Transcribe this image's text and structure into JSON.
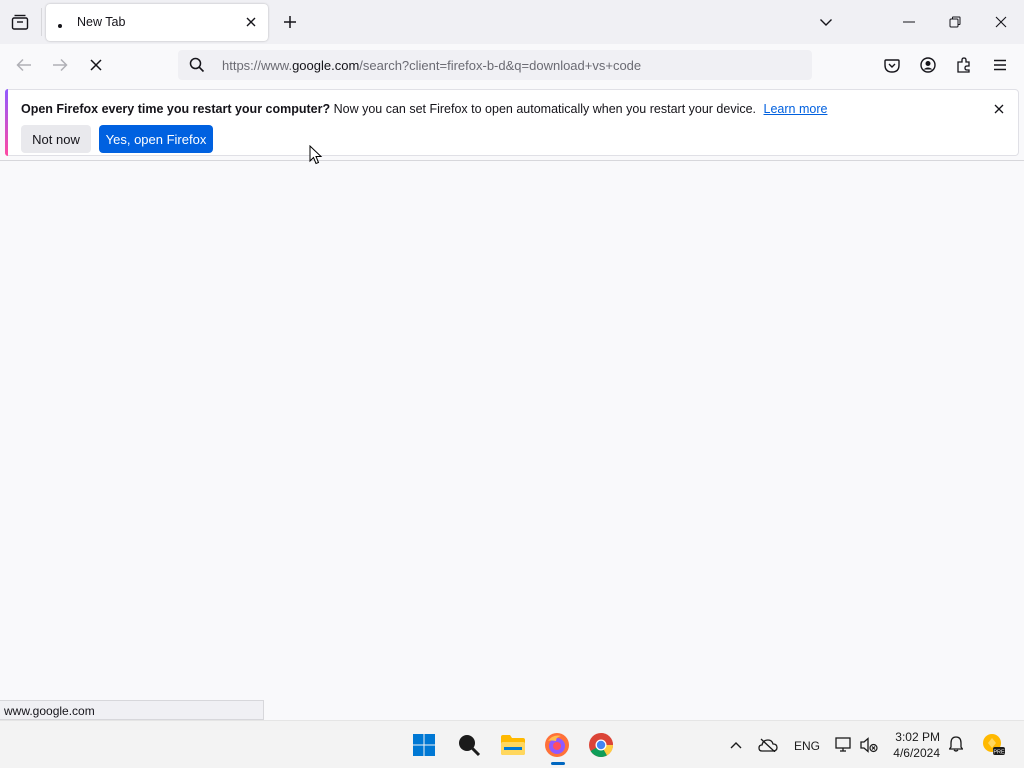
{
  "tabs": [
    {
      "title": "New Tab"
    }
  ],
  "urlbar": {
    "prefix": "https://www.",
    "host": "google.com",
    "rest": "/search?client=firefox-b-d&q=download+vs+code"
  },
  "notification": {
    "headline": "Open Firefox every time you restart your computer?",
    "body": " Now you can set Firefox to open automatically when you restart your device.",
    "link": "Learn more",
    "secondary_button": "Not now",
    "primary_button": "Yes, open Firefox"
  },
  "status_text": "www.google.com",
  "taskbar": {
    "apps": [
      "windows-start",
      "search",
      "file-explorer",
      "firefox",
      "chrome"
    ],
    "language": "ENG",
    "time": "3:02 PM",
    "date": "4/6/2024"
  },
  "colors": {
    "accent_blue": "#0061e0",
    "link_blue": "#0060df",
    "tab_strip": "#f0f0f4",
    "page_bg": "#f9f9fb"
  },
  "icons": [
    "tab-list-icon",
    "globe-favicon-icon",
    "close-tab-icon",
    "new-tab-icon",
    "tab-overflow-chevron-icon",
    "minimize-icon",
    "restore-icon",
    "close-window-icon",
    "back-icon",
    "forward-icon",
    "stop-loading-icon",
    "search-icon",
    "pocket-icon",
    "account-icon",
    "extensions-icon",
    "menu-icon",
    "dismiss-icon"
  ]
}
